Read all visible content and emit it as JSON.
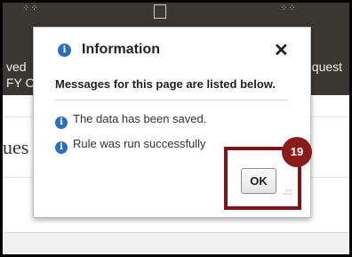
{
  "app": {
    "header_left_line1": "ved",
    "header_left_line2": "FY C",
    "header_right": "equest",
    "body_text": "ues"
  },
  "dialog": {
    "title": "Information",
    "close_label": "✕",
    "subtitle": "Messages for this page are listed below.",
    "messages": [
      {
        "icon": "info-icon",
        "text": "The data has been saved."
      },
      {
        "icon": "info-icon",
        "text": "Rule was run successfully"
      }
    ],
    "ok_label": "OK"
  },
  "callout": {
    "step_number": "19"
  },
  "colors": {
    "header_bg": "#3a3632",
    "info_blue": "#2c6ebd",
    "callout_red": "#8a1c1e"
  }
}
